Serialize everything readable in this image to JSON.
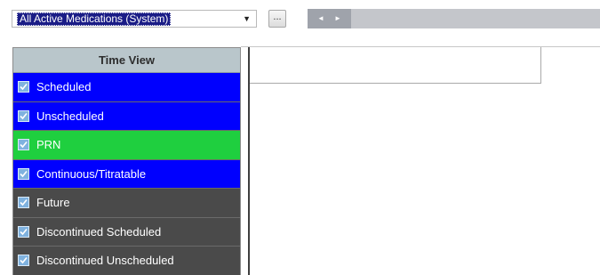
{
  "toolbar": {
    "medication_filter": "All Active Medications (System)",
    "dropdown_arrow": "▼",
    "more_button_label": "...",
    "scroll_left": "◄",
    "scroll_right": "►"
  },
  "time_view": {
    "header": "Time View",
    "categories": [
      {
        "label": "Scheduled",
        "checked": true,
        "color": "#0000fe"
      },
      {
        "label": "Unscheduled",
        "checked": true,
        "color": "#0000fe"
      },
      {
        "label": "PRN",
        "checked": true,
        "color": "#1fcf3f"
      },
      {
        "label": "Continuous/Titratable",
        "checked": true,
        "color": "#0000fe"
      },
      {
        "label": "Future",
        "checked": true,
        "color": "#4a4a4a"
      },
      {
        "label": "Discontinued Scheduled",
        "checked": true,
        "color": "#4a4a4a"
      },
      {
        "label": "Discontinued Unscheduled",
        "checked": true,
        "color": "#4a4a4a"
      }
    ]
  },
  "colors": {
    "scheduled_blue": "#0000fe",
    "prn_green": "#1fcf3f",
    "inactive_gray": "#4a4a4a",
    "header_bg": "#b9c6cb",
    "selection_bg": "#1a1c86"
  },
  "icons": {
    "checkbox": "checkbox-checked-icon",
    "dropdown": "chevron-down-icon",
    "scroll_left": "arrow-left-icon",
    "scroll_right": "arrow-right-icon"
  }
}
